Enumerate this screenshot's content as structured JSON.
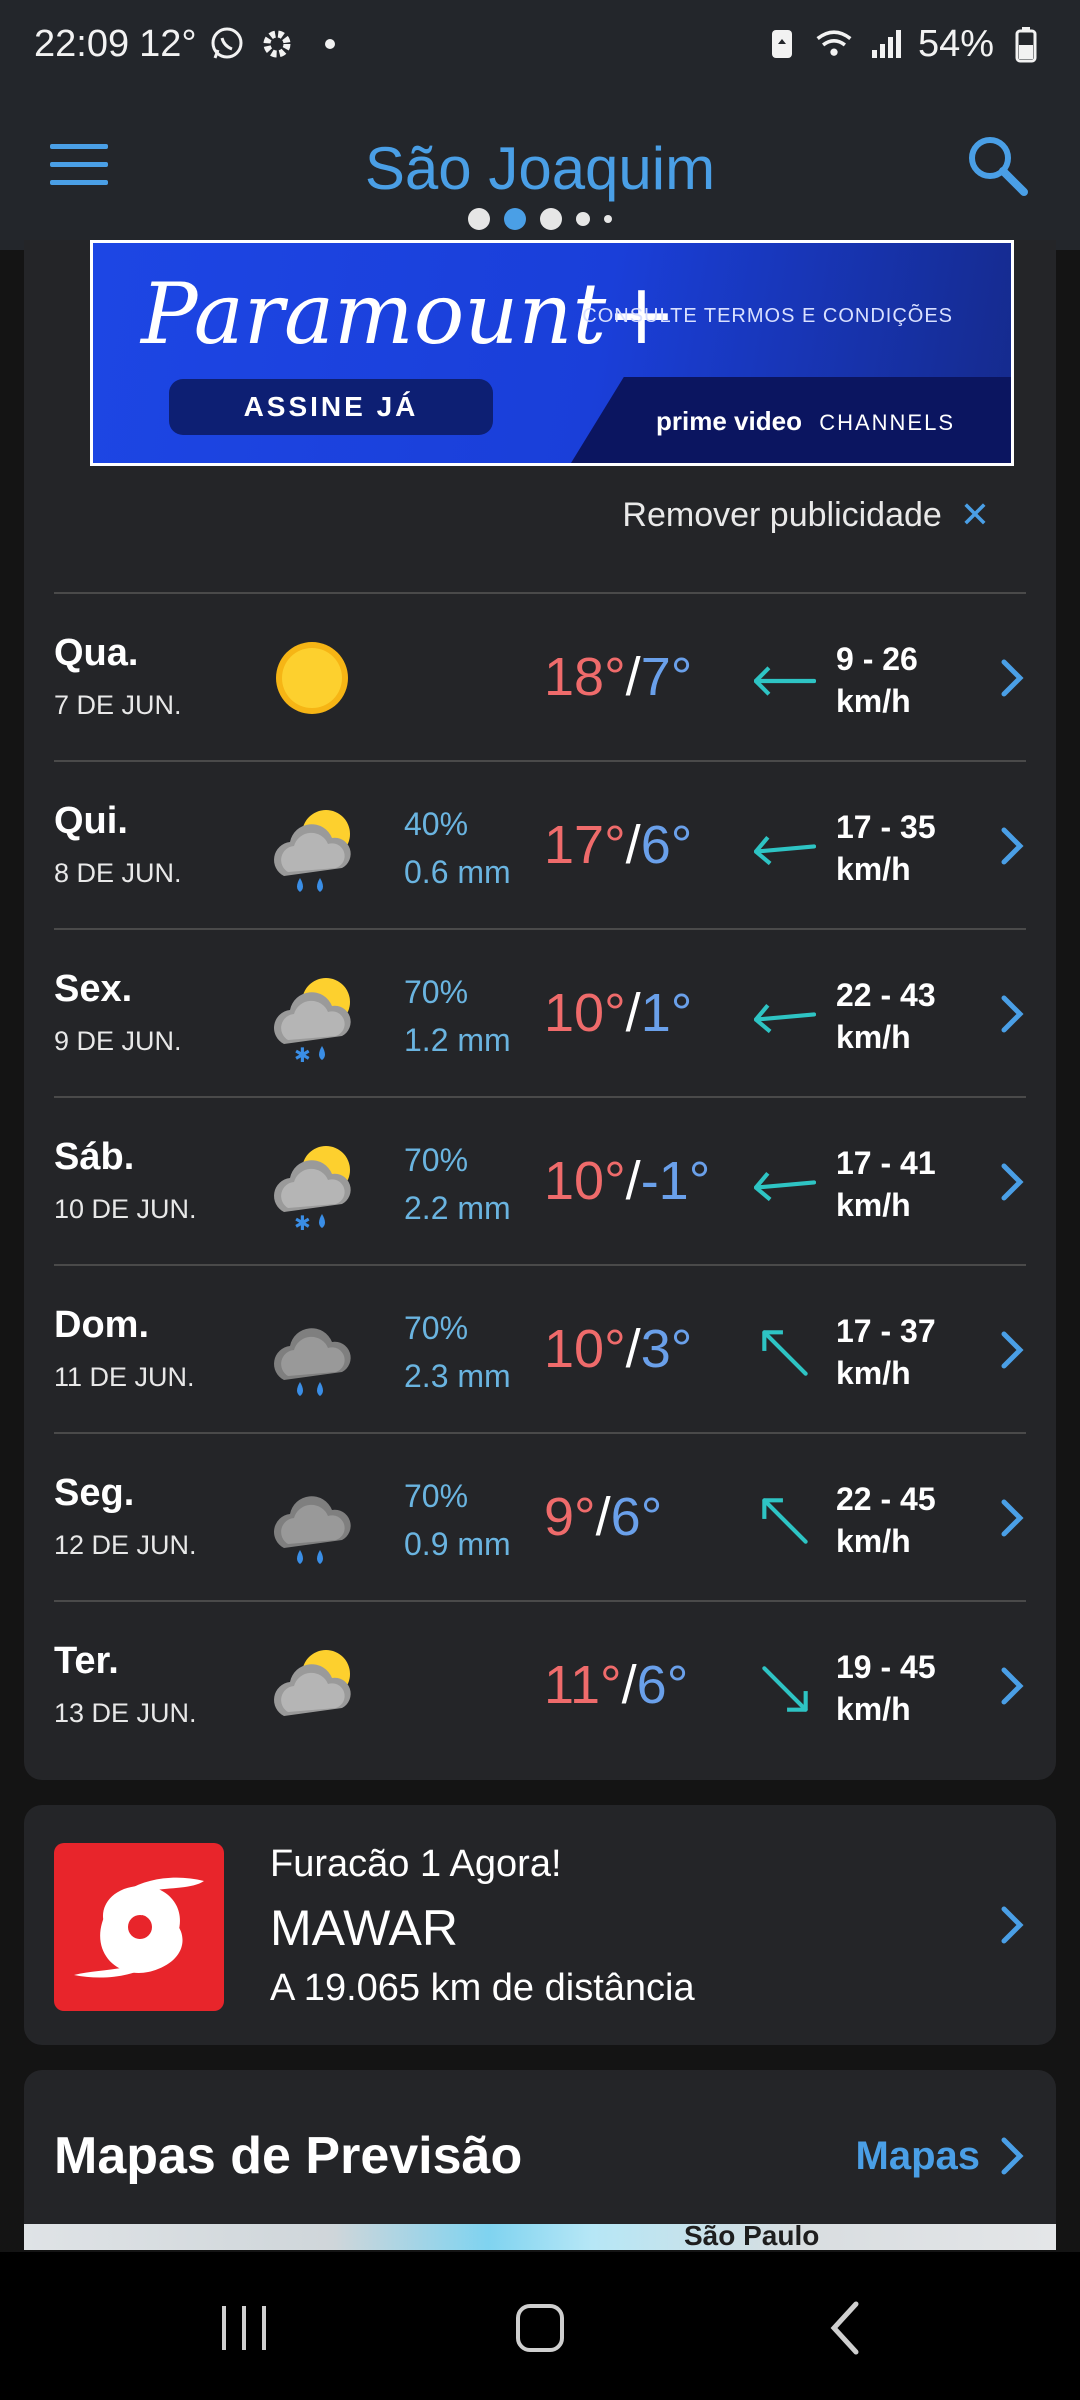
{
  "status_bar": {
    "time": "22:09",
    "temp": "12°",
    "battery": "54%",
    "icons": [
      "whatsapp-icon",
      "gear-icon",
      "battery-saver-icon",
      "wifi-icon",
      "signal-icon",
      "battery-icon"
    ]
  },
  "header": {
    "title": "São Joaquim",
    "pages": 5,
    "active_page": 2
  },
  "ad": {
    "brand": "Paramount+",
    "terms": "CONSULTE TERMOS E CONDIÇÕES",
    "cta": "ASSINE JÁ",
    "partner": "prime video",
    "partner_suffix": "CHANNELS",
    "remove_label": "Remover publicidade"
  },
  "forecast": [
    {
      "day": "Qua.",
      "date": "7 DE JUN.",
      "icon": "sun-icon",
      "chance": "",
      "amount": "",
      "high": "18°",
      "low": "7°",
      "wind": "9 - 26",
      "unit": "km/h",
      "wind_icon": "wind-arrow-icon"
    },
    {
      "day": "Qui.",
      "date": "8 DE JUN.",
      "icon": "rain-sun-icon",
      "chance": "40%",
      "amount": "0.6 mm",
      "high": "17°",
      "low": "6°",
      "wind": "17 - 35",
      "unit": "km/h",
      "wind_icon": "wind-arrow-icon"
    },
    {
      "day": "Sex.",
      "date": "9 DE JUN.",
      "icon": "sleet-sun-icon",
      "chance": "70%",
      "amount": "1.2 mm",
      "high": "10°",
      "low": "1°",
      "wind": "22 - 43",
      "unit": "km/h",
      "wind_icon": "wind-arrow-icon"
    },
    {
      "day": "Sáb.",
      "date": "10 DE JUN.",
      "icon": "sleet-sun-icon",
      "chance": "70%",
      "amount": "2.2 mm",
      "high": "10°",
      "low": "-1°",
      "wind": "17 - 41",
      "unit": "km/h",
      "wind_icon": "wind-arrow-icon"
    },
    {
      "day": "Dom.",
      "date": "11 DE JUN.",
      "icon": "rain-icon",
      "chance": "70%",
      "amount": "2.3 mm",
      "high": "10°",
      "low": "3°",
      "wind": "17 - 37",
      "unit": "km/h",
      "wind_icon": "wind-arrow-icon"
    },
    {
      "day": "Seg.",
      "date": "12 DE JUN.",
      "icon": "rain-icon",
      "chance": "70%",
      "amount": "0.9 mm",
      "high": "9°",
      "low": "6°",
      "wind": "22 - 45",
      "unit": "km/h",
      "wind_icon": "wind-arrow-icon"
    },
    {
      "day": "Ter.",
      "date": "13 DE JUN.",
      "icon": "cloud-sun-icon",
      "chance": "",
      "amount": "",
      "high": "11°",
      "low": "6°",
      "wind": "19 - 45",
      "unit": "km/h",
      "wind_icon": "wind-arrow-icon"
    }
  ],
  "hurricane": {
    "kicker": "Furacão 1 Agora!",
    "name": "MAWAR",
    "distance": "A 19.065 km de distância"
  },
  "maps": {
    "title": "Mapas de Previsão",
    "link": "Mapas",
    "map_label": "São Paulo"
  },
  "colors": {
    "accent": "#4a9fe6",
    "high_temp": "#ef6b6b",
    "low_temp": "#6aa0ea",
    "precip": "#6ab4e0",
    "wind_icon": "#2ec4c4",
    "hurricane": "#e8252b"
  }
}
